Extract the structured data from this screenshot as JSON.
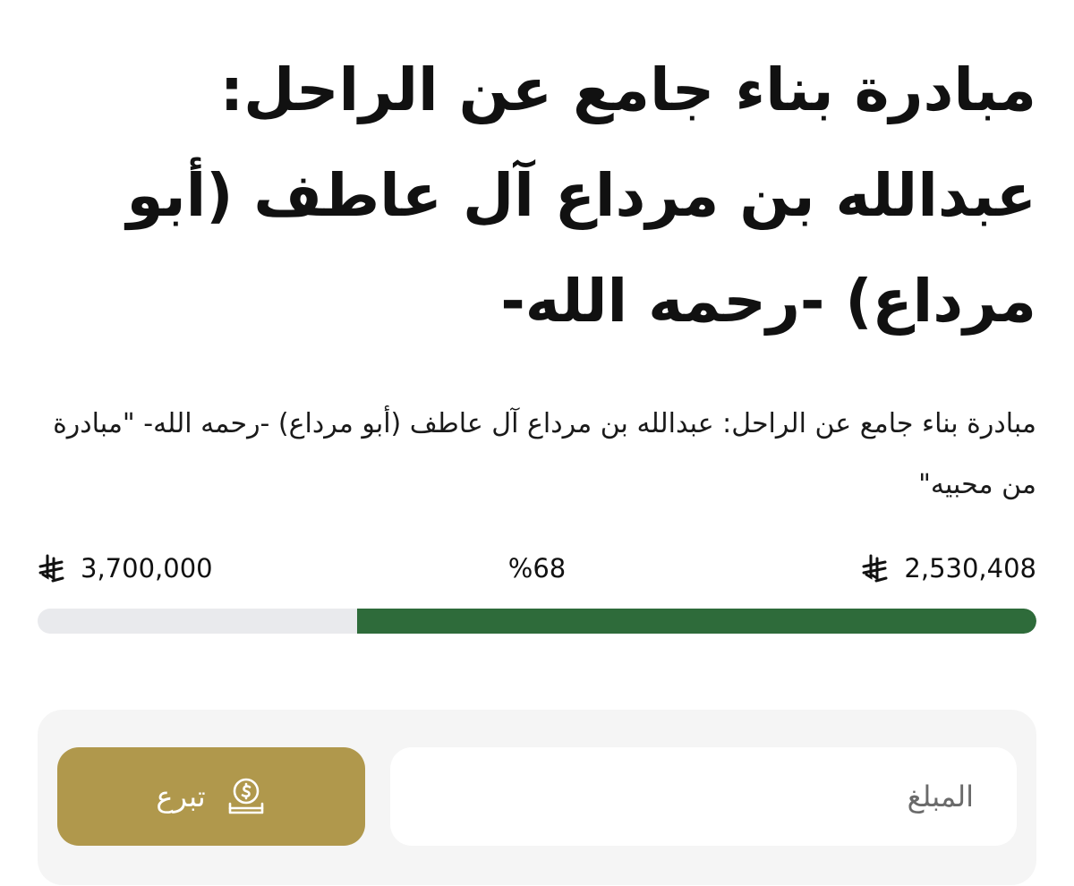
{
  "initiative": {
    "title": "مبادرة بناء جامع عن الراحل: عبدالله بن مرداع آل عاطف (أبو مرداع) -رحمه الله-",
    "description": "مبادرة بناء جامع عن الراحل: عبدالله بن مرداع آل عاطف (أبو مرداع) -رحمه الله- \"مبادرة من محبيه\""
  },
  "progress": {
    "raised": "2,530,408",
    "goal": "3,700,000",
    "percent_label": "%68",
    "fraction": 0.68,
    "currency_icon": "saudi-riyal-icon",
    "fill_color": "#2e6b3a",
    "track_color": "#e9eaed"
  },
  "donate": {
    "amount_placeholder": "المبلغ",
    "button_label": "تبرع",
    "button_icon": "coin-hand-icon",
    "button_color": "#b0984c"
  }
}
